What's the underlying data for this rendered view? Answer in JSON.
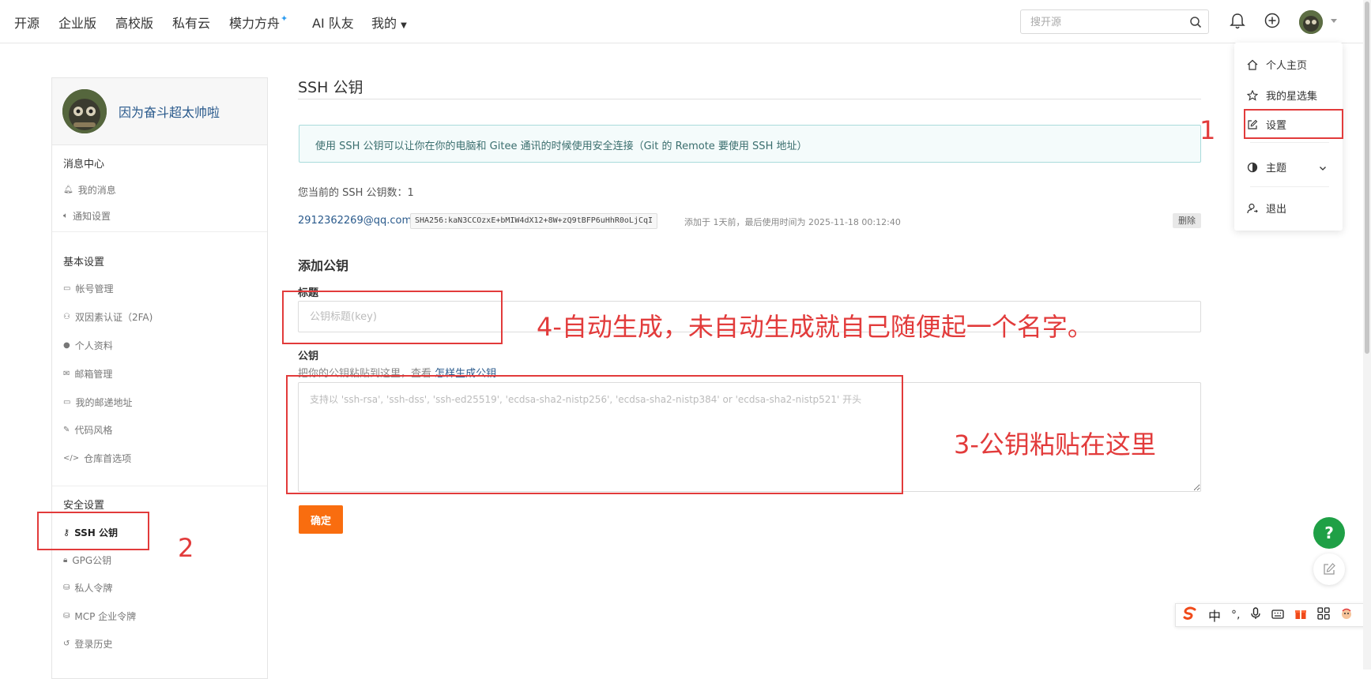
{
  "nav": {
    "items": [
      "开源",
      "企业版",
      "高校版",
      "私有云",
      "模力方舟",
      "AI 队友",
      "我的"
    ],
    "search_placeholder": "搜开源"
  },
  "dropdown": {
    "items": [
      "个人主页",
      "我的星选集",
      "设置",
      "主题",
      "退出"
    ]
  },
  "sidebar": {
    "username": "因为奋斗超太帅啦",
    "sections": [
      {
        "title": "消息中心",
        "items": [
          "我的消息",
          "通知设置"
        ]
      },
      {
        "title": "基本设置",
        "items": [
          "帐号管理",
          "双因素认证（2FA)",
          "个人资料",
          "邮箱管理",
          "我的邮递地址",
          "代码风格",
          "仓库首选项"
        ]
      },
      {
        "title": "安全设置",
        "items": [
          "SSH 公钥",
          "GPG公钥",
          "私人令牌",
          "MCP 企业令牌",
          "登录历史"
        ]
      }
    ]
  },
  "main": {
    "title": "SSH 公钥",
    "info": "使用 SSH 公钥可以让你在你的电脑和 Gitee 通讯的时候使用安全连接（Git 的 Remote 要使用 SSH 地址）",
    "count_label": "您当前的 SSH 公钥数：",
    "count_value": "1",
    "key": {
      "email": "2912362269@qq.com",
      "fingerprint": "SHA256:kaN3CCOzxE+bMIW4dX12+8W+zQ9tBFP6uHhR0oLjCqI",
      "meta": "添加于 1天前，最后使用时间为 2025-11-18 00:12:40",
      "delete_label": "删除"
    },
    "add_title": "添加公钥",
    "title_label": "标题",
    "title_placeholder": "公钥标题(key)",
    "key_label": "公钥",
    "hint_text": "把你的公钥粘贴到这里，查看 ",
    "hint_link": "怎样生成公钥",
    "key_placeholder": "支持以 'ssh-rsa', 'ssh-dss', 'ssh-ed25519', 'ecdsa-sha2-nistp256', 'ecdsa-sha2-nistp384' or 'ecdsa-sha2-nistp521' 开头",
    "submit_label": "确定"
  },
  "annotations": {
    "step1": "1",
    "step2": "2",
    "step3": "3-公钥粘贴在这里",
    "step4": "4-自动生成，未自动生成就自己随便起一个名字。"
  },
  "floating": {
    "help": "?"
  },
  "ime": {
    "lang": "中"
  },
  "colors": {
    "accent_orange": "#f96d0f",
    "link_blue": "#2a5a8c",
    "annotation_red": "#e23b3b",
    "help_green": "#1fa046",
    "info_bg": "#f4fbfb"
  }
}
